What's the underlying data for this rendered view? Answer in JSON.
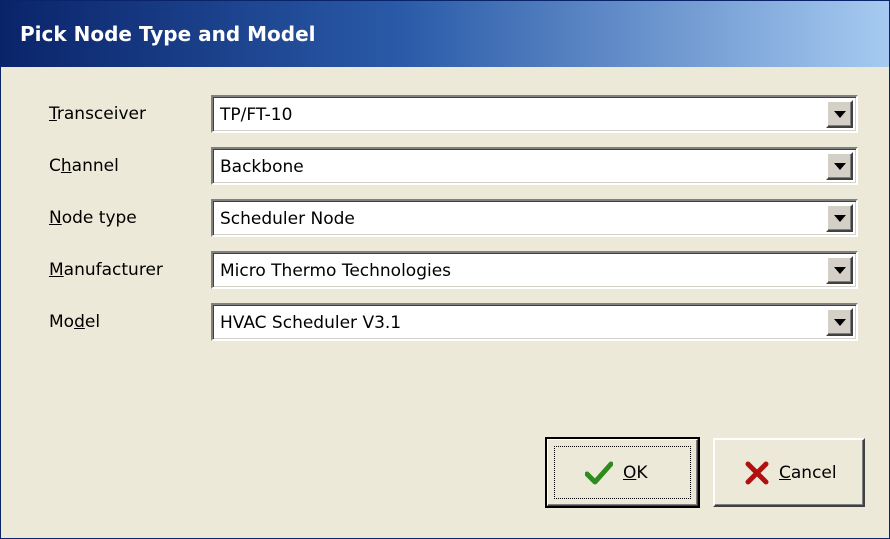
{
  "dialog": {
    "title": "Pick Node Type and Model"
  },
  "fields": [
    {
      "label": "Transceiver",
      "mnemonic_index": 0,
      "value": "TP/FT-10"
    },
    {
      "label": "Channel",
      "mnemonic_index": 1,
      "value": "Backbone"
    },
    {
      "label": "Node type",
      "mnemonic_index": 0,
      "value": "Scheduler Node"
    },
    {
      "label": "Manufacturer",
      "mnemonic_index": 0,
      "value": "Micro Thermo Technologies"
    },
    {
      "label": "Model",
      "mnemonic_index": 2,
      "value": "HVAC Scheduler V3.1"
    }
  ],
  "buttons": {
    "ok": {
      "label": "OK",
      "mnemonic_index": 0,
      "icon": "checkmark-icon",
      "color": "#2e8b1e"
    },
    "cancel": {
      "label": "Cancel",
      "mnemonic_index": 0,
      "icon": "x-icon",
      "color": "#b01010"
    }
  },
  "colors": {
    "title_gradient_start": "#0a246a",
    "title_gradient_end": "#a6caf0",
    "dialog_bg": "#ece9d8"
  }
}
